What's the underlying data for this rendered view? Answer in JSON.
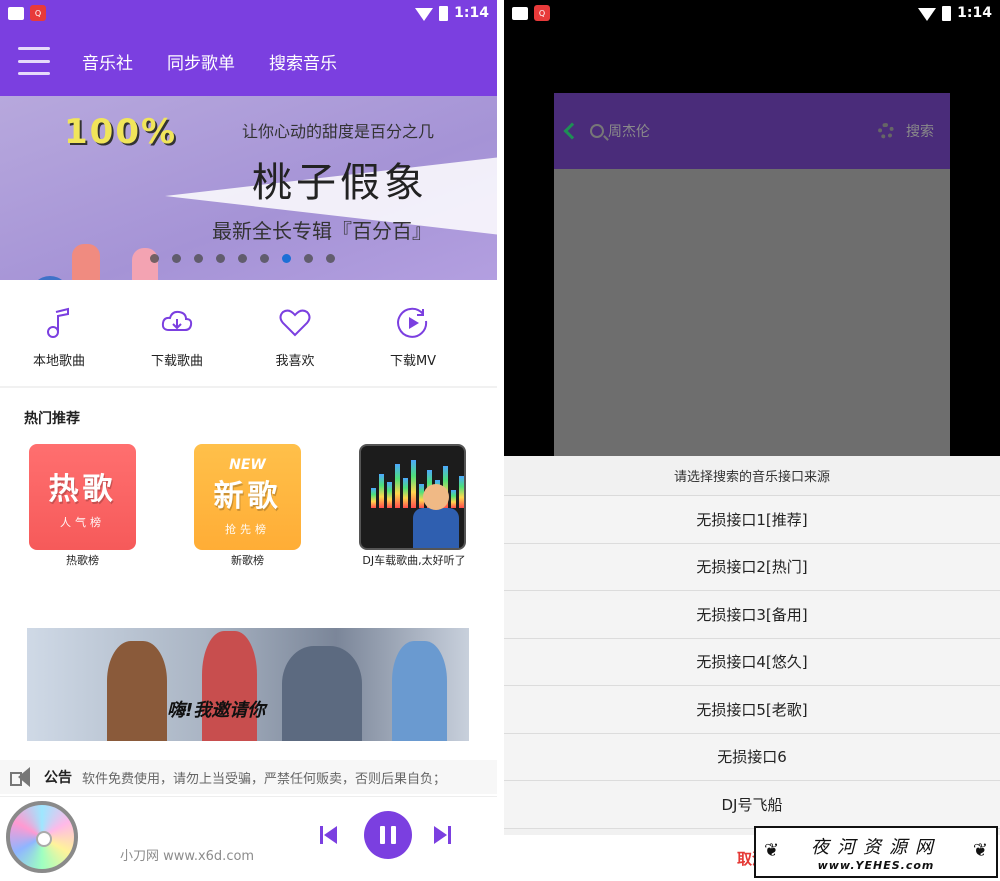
{
  "status_bar": {
    "time": "1:14",
    "app_badge": "Q"
  },
  "left": {
    "nav": {
      "tabs": [
        "音乐社",
        "同步歌单",
        "搜索音乐"
      ]
    },
    "banner": {
      "percent": "100%",
      "tagline": "让你心动的甜度是百分之几",
      "title": "桃子假象",
      "subtitle": "最新全长专辑『百分百』",
      "dots": 9,
      "active_dot": 6
    },
    "quick_actions": [
      {
        "icon": "music-note-icon",
        "label": "本地歌曲"
      },
      {
        "icon": "cloud-download-icon",
        "label": "下载歌曲"
      },
      {
        "icon": "heart-icon",
        "label": "我喜欢"
      },
      {
        "icon": "play-circle-icon",
        "label": "下载MV"
      }
    ],
    "hot": {
      "title": "热门推荐",
      "cards": [
        {
          "big": "热歌",
          "small": "人气榜",
          "label": "热歌榜"
        },
        {
          "new": "NEW",
          "big": "新歌",
          "small": "抢先榜",
          "label": "新歌榜"
        },
        {
          "label": "DJ车载歌曲,太好听了"
        }
      ]
    },
    "ad": {
      "slogan": "嗨!我邀请你"
    },
    "notice": {
      "label": "公告",
      "text": "软件免费使用，请勿上当受骗，严禁任何贩卖，否则后果自负；"
    },
    "player": {
      "watermark": "小刀网 www.x6d.com"
    }
  },
  "right": {
    "search": {
      "query": "周杰伦",
      "button": "搜索"
    },
    "sheet": {
      "title": "请选择搜索的音乐接口来源",
      "items": [
        "无损接口1[推荐]",
        "无损接口2[热门]",
        "无损接口3[备用]",
        "无损接口4[悠久]",
        "无损接口5[老歌]",
        "无损接口6",
        "DJ号飞船"
      ],
      "cancel": "取消"
    }
  },
  "site_watermark": {
    "name": "夜河资源网",
    "url": "www.YEHES.com"
  },
  "colors": {
    "primary": "#7b3fe0",
    "cancel": "#e53935",
    "dot_active": "#1c6fd6"
  }
}
